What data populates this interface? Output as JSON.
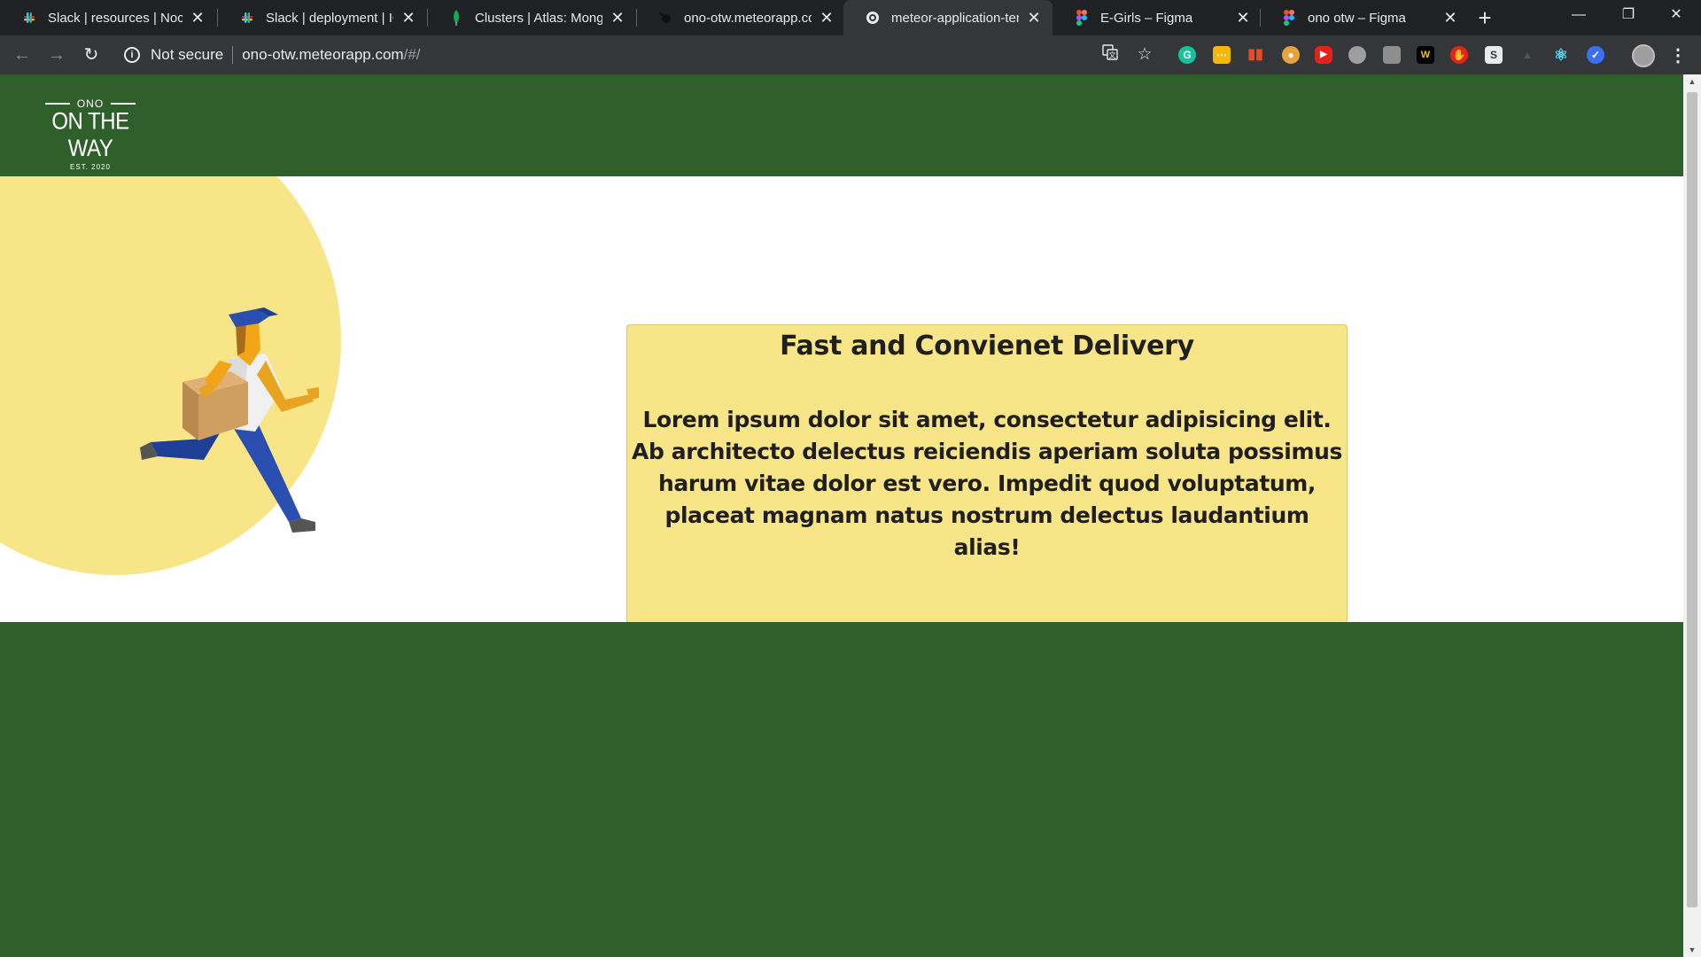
{
  "browser": {
    "tabs": [
      {
        "title": "Slack | resources | Noculab",
        "favicon": "slack-icon",
        "active": false
      },
      {
        "title": "Slack | deployment | ICS",
        "favicon": "slack-icon",
        "active": false
      },
      {
        "title": "Clusters | Atlas: MongoDB",
        "favicon": "mongodb-leaf-icon",
        "active": false
      },
      {
        "title": "ono-otw.meteorapp.com",
        "favicon": "meteor-icon",
        "active": false
      },
      {
        "title": "meteor-application-template",
        "favicon": "github-icon",
        "active": true
      },
      {
        "title": "E-Girls – Figma",
        "favicon": "figma-icon",
        "active": false
      },
      {
        "title": "ono otw – Figma",
        "favicon": "figma-icon",
        "active": false
      }
    ],
    "new_tab": "+",
    "window_controls": {
      "minimize": "—",
      "restore": "❐",
      "close": "✕"
    },
    "nav": {
      "back": "←",
      "forward": "→",
      "reload": "↻"
    },
    "address_bar": {
      "security": "Not secure",
      "host": "ono-otw.meteorapp.com",
      "path": "/#/"
    },
    "extensions": [
      "translate-icon",
      "bookmark-star-icon",
      "grammarly-icon",
      "keep-icon",
      "stats-icon",
      "color-picker-icon",
      "youtube-icon",
      "extension-gray-icon",
      "notepad-icon",
      "wappalyzer-icon",
      "adblock-icon",
      "s-icon",
      "mouse-icon",
      "react-devtools-icon",
      "tool-icon"
    ],
    "colors": {
      "frame": "#202124",
      "toolbar": "#35363a"
    }
  },
  "site": {
    "logo": {
      "top": "ONO",
      "main": "ON THE WAY",
      "est": "EST. 2020"
    },
    "hero": {
      "image": "delivery-courier-illustration",
      "card_title": "Fast and Convienet Delivery",
      "card_body": "Lorem ipsum dolor sit amet, consectetur adipisicing elit. Ab architecto delectus reiciendis aperiam soluta possimus harum vitae dolor est vero. Impedit quod voluptatum, placeat magnam natus nostrum delectus laudantium alias!"
    },
    "colors": {
      "brand_green": "#2f602c",
      "accent_yellow": "#f8e588",
      "background": "#ffffff"
    }
  }
}
